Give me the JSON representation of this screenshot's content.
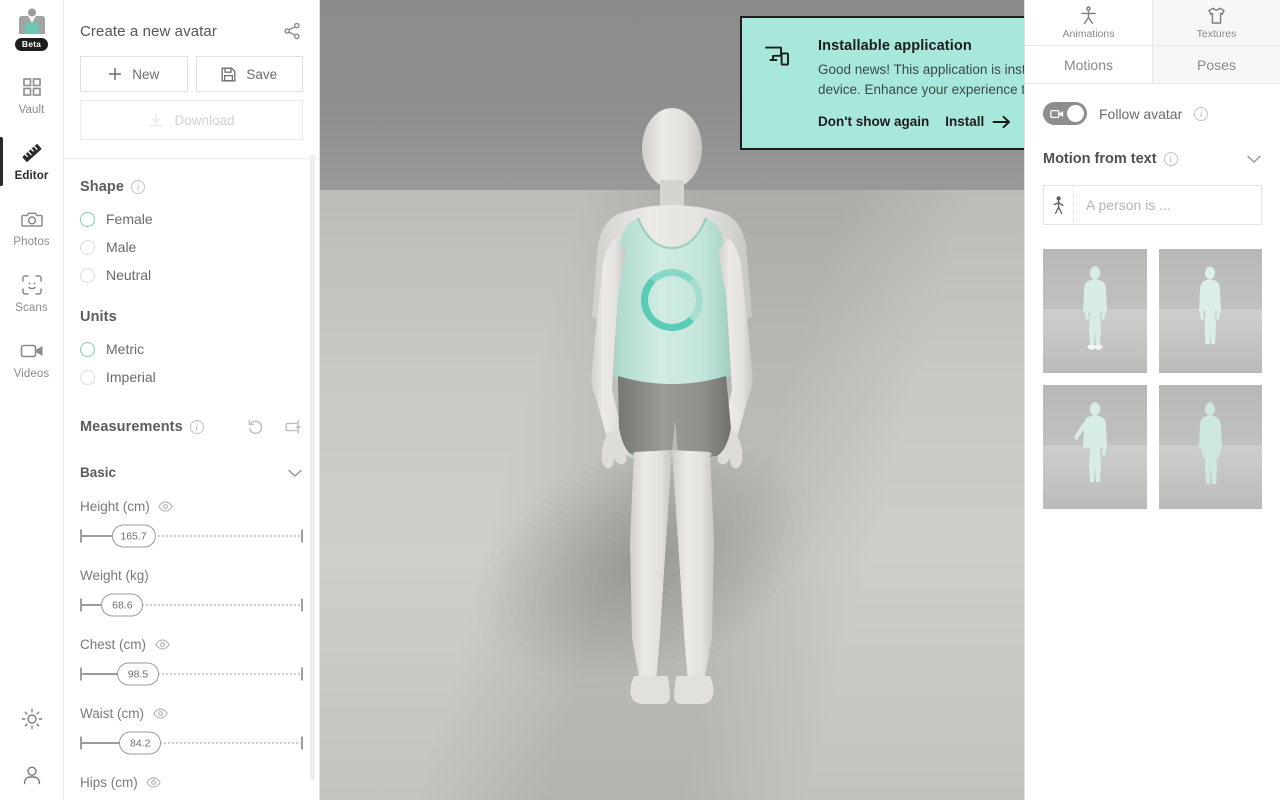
{
  "rail": {
    "logo_badge": "Beta",
    "items": [
      {
        "label": "Vault",
        "icon": "grid-icon",
        "active": false
      },
      {
        "label": "Editor",
        "icon": "ruler-icon",
        "active": true
      },
      {
        "label": "Photos",
        "icon": "camera-icon",
        "active": false
      },
      {
        "label": "Scans",
        "icon": "scan-face-icon",
        "active": false
      },
      {
        "label": "Videos",
        "icon": "video-icon",
        "active": false
      }
    ],
    "bottom": [
      {
        "name": "theme-toggle",
        "icon": "sun-icon"
      },
      {
        "name": "account-button",
        "icon": "user-icon"
      }
    ]
  },
  "left_panel": {
    "title": "Create a new avatar",
    "share_icon": "share-icon",
    "buttons": {
      "new": "New",
      "save": "Save",
      "download": "Download"
    },
    "shape": {
      "title": "Shape",
      "options": [
        {
          "label": "Female",
          "selected": true
        },
        {
          "label": "Male",
          "selected": false
        },
        {
          "label": "Neutral",
          "selected": false
        }
      ]
    },
    "units": {
      "title": "Units",
      "options": [
        {
          "label": "Metric",
          "selected": true
        },
        {
          "label": "Imperial",
          "selected": false
        }
      ]
    },
    "measurements": {
      "title": "Measurements",
      "actions": [
        {
          "name": "reset-measurements",
          "icon": "undo-icon"
        },
        {
          "name": "measure-tool",
          "icon": "ruler-measure-icon"
        }
      ],
      "group": {
        "title": "Basic",
        "expanded": true
      },
      "sliders": [
        {
          "label": "Height (cm)",
          "value": "165.7",
          "percent": 24,
          "eye": true
        },
        {
          "label": "Weight (kg)",
          "value": "68.6",
          "percent": 19,
          "eye": false
        },
        {
          "label": "Chest (cm)",
          "value": "98.5",
          "percent": 26,
          "eye": true
        },
        {
          "label": "Waist (cm)",
          "value": "84.2",
          "percent": 27,
          "eye": true
        },
        {
          "label": "Hips (cm)",
          "value": "",
          "percent": 0,
          "eye": true
        }
      ]
    }
  },
  "banner": {
    "icon": "devices-icon",
    "title": "Installable application",
    "text": "Good news! This application is installable on your device. Enhance your experience today!",
    "dismiss_label": "Don't show again",
    "install_label": "Install",
    "close_icon": "close-icon",
    "bg_color": "#a8e8dc",
    "border_color": "#1c1c1c"
  },
  "viewport": {
    "spinner_color": "#4dc8b2",
    "avatar_top_color": "#bfe6da",
    "avatar_shorts_color": "#8e8e8a"
  },
  "right_panel": {
    "top_tabs": [
      {
        "label": "Animations",
        "icon": "person-icon",
        "active": true
      },
      {
        "label": "Textures",
        "icon": "tshirt-icon",
        "active": false
      }
    ],
    "sub_tabs": [
      {
        "label": "Motions",
        "active": true
      },
      {
        "label": "Poses",
        "active": false
      }
    ],
    "follow_avatar": {
      "label": "Follow avatar",
      "enabled": true,
      "icon": "video-camera-icon"
    },
    "motion_from_text": {
      "title": "Motion from text",
      "input_placeholder": "A person is ...",
      "input_value": "",
      "input_icon": "walking-person-icon"
    },
    "thumbnails": [
      {
        "name": "motion-thumb-1"
      },
      {
        "name": "motion-thumb-2"
      },
      {
        "name": "motion-thumb-3"
      },
      {
        "name": "motion-thumb-4"
      }
    ]
  }
}
